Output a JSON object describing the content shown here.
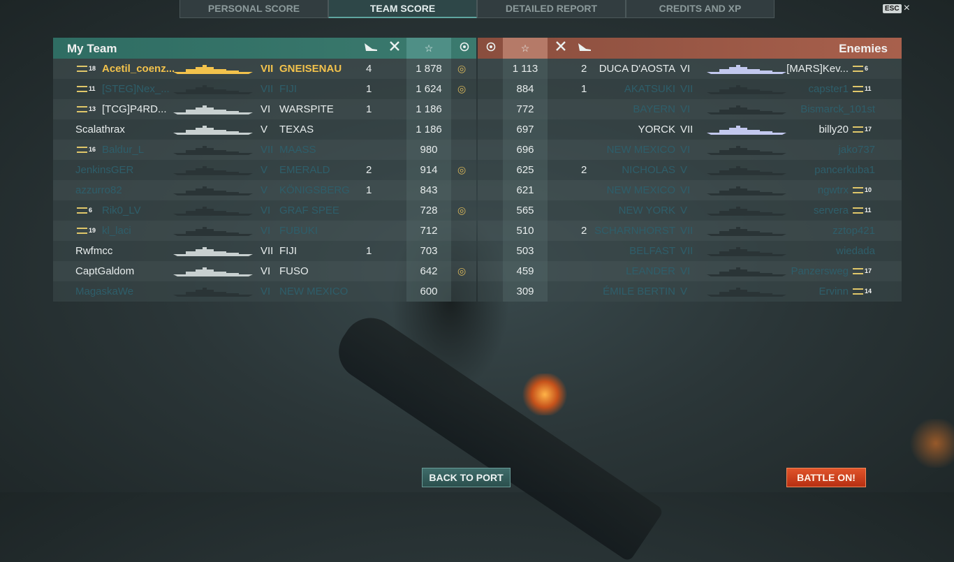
{
  "tabs": [
    {
      "label": "PERSONAL SCORE"
    },
    {
      "label": "TEAM SCORE"
    },
    {
      "label": "DETAILED REPORT"
    },
    {
      "label": "CREDITS AND XP"
    }
  ],
  "esc_label": "ESC",
  "close_icon": "×",
  "my_team": {
    "title": "My Team",
    "rows": [
      {
        "rank": "18",
        "name": "Acetil_coenz...",
        "tier": "VII",
        "ship": "GNEISENAU",
        "kills": "4",
        "xp": "1 878",
        "badge": true,
        "status": "me"
      },
      {
        "rank": "11",
        "name": "[STEG]Nex_...",
        "tier": "VII",
        "ship": "FIJI",
        "kills": "1",
        "xp": "1 624",
        "badge": true,
        "status": "dead"
      },
      {
        "rank": "13",
        "name": "[TCG]P4RD...",
        "tier": "VI",
        "ship": "WARSPITE",
        "kills": "1",
        "xp": "1 186",
        "badge": false,
        "status": "alive"
      },
      {
        "rank": "",
        "name": "Scalathrax",
        "tier": "V",
        "ship": "TEXAS",
        "kills": "",
        "xp": "1 186",
        "badge": false,
        "status": "alive"
      },
      {
        "rank": "16",
        "name": "Baldur_L",
        "tier": "VII",
        "ship": "MAASS",
        "kills": "",
        "xp": "980",
        "badge": false,
        "status": "dead"
      },
      {
        "rank": "",
        "name": "JenkinsGER",
        "tier": "V",
        "ship": "EMERALD",
        "kills": "2",
        "xp": "914",
        "badge": true,
        "status": "dead"
      },
      {
        "rank": "",
        "name": "azzurro82",
        "tier": "V",
        "ship": "KÖNIGSBERG",
        "kills": "1",
        "xp": "843",
        "badge": false,
        "status": "dead"
      },
      {
        "rank": "6",
        "name": "Rik0_LV",
        "tier": "VI",
        "ship": "GRAF SPEE",
        "kills": "",
        "xp": "728",
        "badge": true,
        "status": "dead"
      },
      {
        "rank": "19",
        "name": "kl_laci",
        "tier": "VI",
        "ship": "FUBUKI",
        "kills": "",
        "xp": "712",
        "badge": false,
        "status": "dead"
      },
      {
        "rank": "",
        "name": "Rwfmcc",
        "tier": "VII",
        "ship": "FIJI",
        "kills": "1",
        "xp": "703",
        "badge": false,
        "status": "alive"
      },
      {
        "rank": "",
        "name": "CaptGaldom",
        "tier": "VI",
        "ship": "FUSO",
        "kills": "",
        "xp": "642",
        "badge": true,
        "status": "alive"
      },
      {
        "rank": "",
        "name": "MagaskaWe",
        "tier": "VI",
        "ship": "NEW MEXICO",
        "kills": "",
        "xp": "600",
        "badge": false,
        "status": "dead"
      }
    ]
  },
  "enemies": {
    "title": "Enemies",
    "rows": [
      {
        "xp": "1 113",
        "kills": "2",
        "ship": "DUCA D'AOSTA",
        "tier": "VI",
        "name": "[MARS]Kev...",
        "rank": "6",
        "status": "alive"
      },
      {
        "xp": "884",
        "kills": "1",
        "ship": "AKATSUKI",
        "tier": "VII",
        "name": "capster1",
        "rank": "11",
        "status": "dead"
      },
      {
        "xp": "772",
        "kills": "",
        "ship": "BAYERN",
        "tier": "VI",
        "name": "Bismarck_101st",
        "rank": "",
        "status": "dead"
      },
      {
        "xp": "697",
        "kills": "",
        "ship": "YORCK",
        "tier": "VII",
        "name": "billy20",
        "rank": "17",
        "status": "alive"
      },
      {
        "xp": "696",
        "kills": "",
        "ship": "NEW MEXICO",
        "tier": "VI",
        "name": "jako737",
        "rank": "",
        "status": "dead"
      },
      {
        "xp": "625",
        "kills": "2",
        "ship": "NICHOLAS",
        "tier": "V",
        "name": "pancerkuba1",
        "rank": "",
        "status": "dead"
      },
      {
        "xp": "621",
        "kills": "",
        "ship": "NEW MEXICO",
        "tier": "VI",
        "name": "ngwtrx",
        "rank": "10",
        "status": "dead"
      },
      {
        "xp": "565",
        "kills": "",
        "ship": "NEW YORK",
        "tier": "V",
        "name": "servera",
        "rank": "11",
        "status": "dead"
      },
      {
        "xp": "510",
        "kills": "2",
        "ship": "SCHARNHORST",
        "tier": "VII",
        "name": "zztop421",
        "rank": "",
        "status": "dead"
      },
      {
        "xp": "503",
        "kills": "",
        "ship": "BELFAST",
        "tier": "VII",
        "name": "wiedada",
        "rank": "",
        "status": "dead"
      },
      {
        "xp": "459",
        "kills": "",
        "ship": "LEANDER",
        "tier": "VI",
        "name": "Panzersweg",
        "rank": "17",
        "status": "dead"
      },
      {
        "xp": "309",
        "kills": "",
        "ship": "ÉMILE BERTIN",
        "tier": "V",
        "name": "Ervinn",
        "rank": "14",
        "status": "dead"
      }
    ]
  },
  "buttons": {
    "back": "BACK TO PORT",
    "battle": "BATTLE ON!"
  },
  "icons": {
    "torpedo": "torpedo-icon",
    "crossed": "crossed-swords-icon",
    "star": "star-icon",
    "badge": "wreath-badge-icon"
  },
  "colors": {
    "accent_team": "#3b7a6e",
    "accent_enemy": "#a8604c",
    "me": "#f2c24c",
    "dead": "#2e5e6a"
  }
}
